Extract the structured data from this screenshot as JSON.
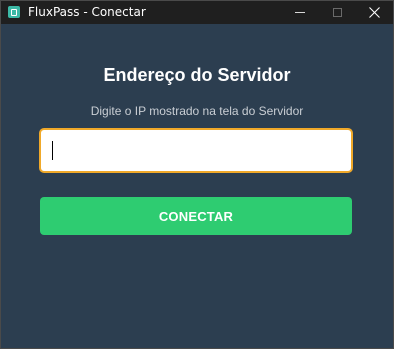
{
  "window": {
    "title": "FluxPass - Conectar",
    "icon": "app-icon"
  },
  "controls": {
    "minimize_icon": "minimize-icon",
    "maximize_icon": "maximize-icon",
    "close_icon": "close-icon",
    "close_glyph": "✕"
  },
  "form": {
    "heading": "Endereço do Servidor",
    "instruction": "Digite o IP mostrado na tela do Servidor",
    "ip_value": "",
    "ip_placeholder": "",
    "connect_label": "CONECTAR"
  },
  "colors": {
    "background": "#2c3e50",
    "titlebar": "#1f1f1f",
    "input_focus_border": "#f0a92a",
    "connect_button": "#2ecc71",
    "app_icon": "#3cb9a6"
  }
}
